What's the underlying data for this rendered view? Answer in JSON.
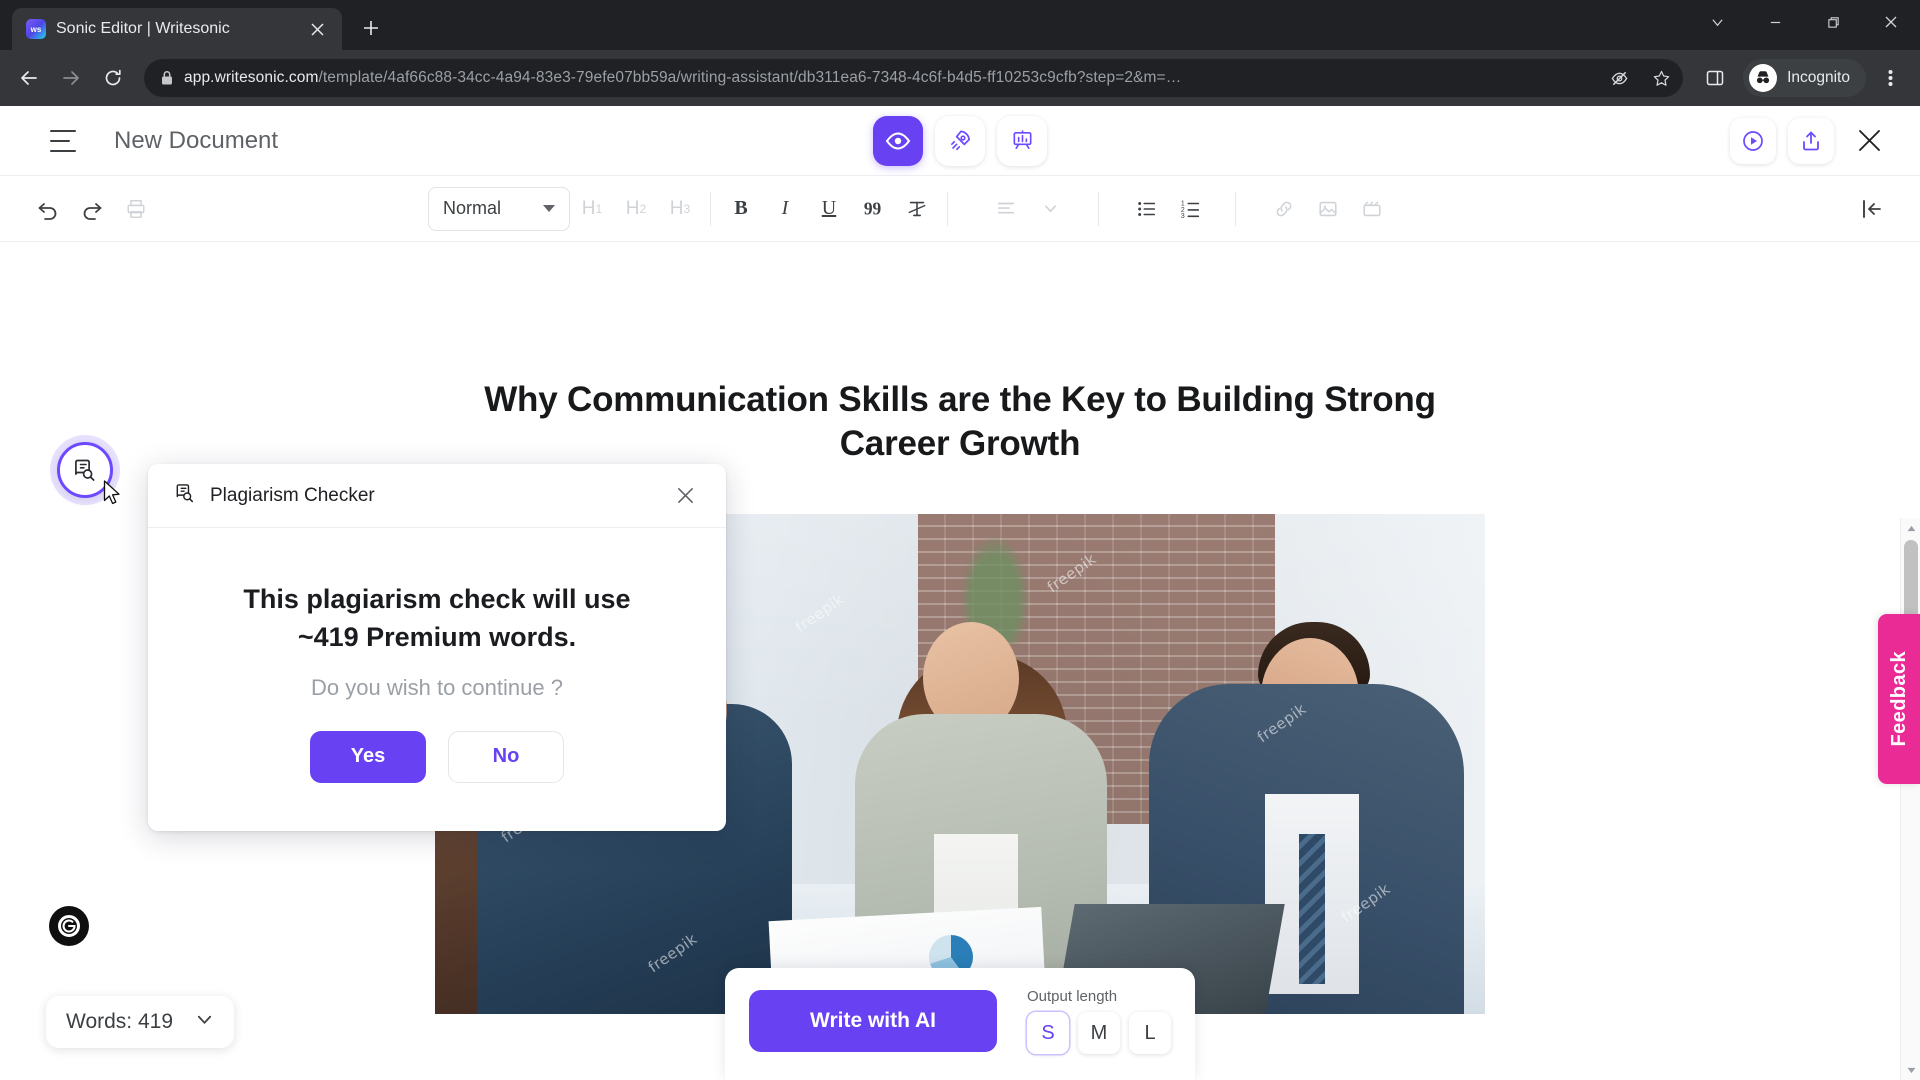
{
  "browser": {
    "tab": {
      "title": "Sonic Editor | Writesonic",
      "favicon": "writesonic-logo-icon",
      "close_label": "×"
    },
    "new_tab_label": "+",
    "window_controls": [
      "chevron-down-icon",
      "minimize-icon",
      "restore-icon",
      "close-icon"
    ],
    "nav": {
      "back": "back-arrow-icon",
      "forward": "forward-arrow-icon",
      "reload": "reload-icon"
    },
    "omnibox": {
      "lock": "lock-icon",
      "host": "app.writesonic.com",
      "path": "/template/4af66c88-34cc-4a94-83e3-79efe07bb59a/writing-assistant/db311ea6-7348-4c6f-b4d5-ff10253c9cfb?step=2&m=…",
      "tracking_icon": "eye-slash-icon",
      "bookmark_icon": "star-icon"
    },
    "sidepanel_icon": "side-panel-icon",
    "profile": {
      "label": "Incognito",
      "icon": "incognito-icon"
    },
    "menu_icon": "three-dot-menu-icon"
  },
  "app_header": {
    "menu_icon": "hamburger-menu-icon",
    "document_title": "New Document",
    "modes": [
      {
        "name": "preview",
        "icon": "eye-icon",
        "active": true
      },
      {
        "name": "boost",
        "icon": "rocket-icon",
        "active": false
      },
      {
        "name": "analytics",
        "icon": "presentation-chart-icon",
        "active": false
      }
    ],
    "actions": [
      {
        "name": "play",
        "icon": "play-circle-icon"
      },
      {
        "name": "export",
        "icon": "share-upload-icon"
      },
      {
        "name": "close",
        "icon": "close-icon"
      }
    ]
  },
  "editor_toolbar": {
    "undo": "undo-icon",
    "redo": "redo-icon",
    "print": "print-icon",
    "style_value": "Normal",
    "headings": [
      "H1",
      "H2",
      "H3"
    ],
    "bold": "B",
    "italic": "I",
    "underline": "U",
    "quote": "quote-icon",
    "clear_format": "clear-format-icon",
    "align": "align-left-icon",
    "align_chevron": "chevron-down-icon",
    "bullet_list": "bullet-list-icon",
    "numbered_list": "numbered-list-icon",
    "link": "link-icon",
    "image": "image-icon",
    "video": "video-icon",
    "collapse": "collapse-panel-icon"
  },
  "document": {
    "heading": "Why Communication Skills are the Key to Building Strong Career Growth",
    "image_watermark": "freepik"
  },
  "dialog": {
    "icon": "document-search-icon",
    "title": "Plagiarism Checker",
    "close_icon": "close-icon",
    "message_line1": "This plagiarism check will use",
    "message_line2": "~419 Premium words.",
    "question": "Do you wish to continue ?",
    "yes_label": "Yes",
    "no_label": "No"
  },
  "left_widgets": {
    "plagiarism_icon": "document-search-icon",
    "grammarly_icon": "grammarly-icon",
    "words_label": "Words: 419",
    "words_chevron": "chevron-down-icon"
  },
  "write_bar": {
    "write_button": "Write with AI",
    "output_length_label": "Output length",
    "lengths": [
      {
        "label": "S",
        "active": true
      },
      {
        "label": "M",
        "active": false
      },
      {
        "label": "L",
        "active": false
      }
    ]
  },
  "feedback": {
    "label": "Feedback",
    "color": "#ea2a95"
  },
  "colors": {
    "accent": "#6841f2",
    "chrome_dark": "#202124",
    "chrome_toolbar": "#35363a",
    "feedback_pink": "#ea2a95"
  }
}
